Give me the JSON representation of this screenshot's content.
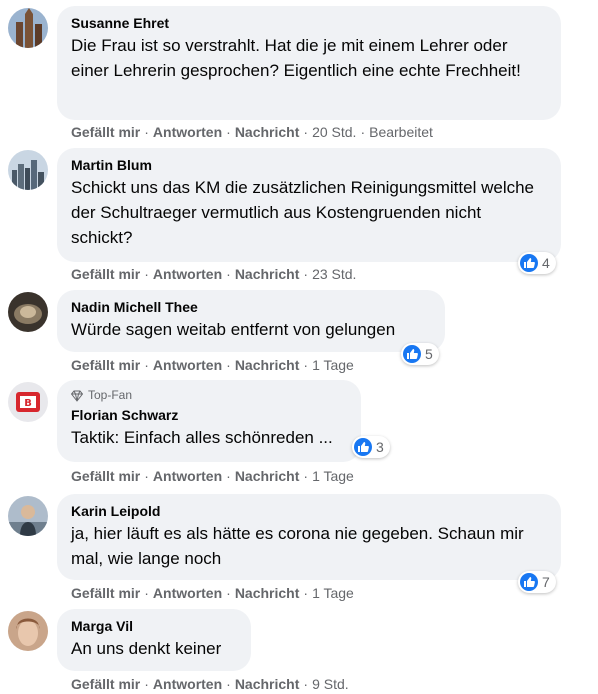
{
  "actions": {
    "like": "Gefällt mir",
    "reply": "Antworten",
    "message": "Nachricht",
    "separator": "·"
  },
  "comments": [
    {
      "author": "Susanne Ehret",
      "text": "Die Frau ist so verstrahlt. Hat die je mit einem Lehrer oder einer Lehrerin gesprochen? Eigentlich eine echte Frechheit!",
      "time": "20 Std.",
      "edited": "Bearbeitet"
    },
    {
      "author": "Martin Blum",
      "text": "Schickt uns das KM die zusätzlichen Reinigungsmittel welche der Schultraeger vermutlich aus Kostengruenden nicht schickt?",
      "time": "23 Std.",
      "reactions": "4"
    },
    {
      "author": "Nadin Michell Thee",
      "text": "Würde sagen weitab entfernt von gelungen",
      "time": "1 Tage",
      "reactions": "5"
    },
    {
      "badge": "Top-Fan",
      "author": "Florian Schwarz",
      "text": "Taktik: Einfach alles schönreden ...",
      "time": "1 Tage",
      "reactions": "3"
    },
    {
      "author": "Karin Leipold",
      "text": "ja, hier läuft es als hätte es corona nie gegeben. Schaun mir mal, wie lange noch",
      "time": "1 Tage",
      "reactions": "7"
    },
    {
      "author": "Marga Vil",
      "text": "An uns denkt keiner",
      "time": "9 Std."
    }
  ],
  "colors": {
    "bubble": "#f0f2f5",
    "meta": "#65676b",
    "like_blue": "#1877f2"
  }
}
